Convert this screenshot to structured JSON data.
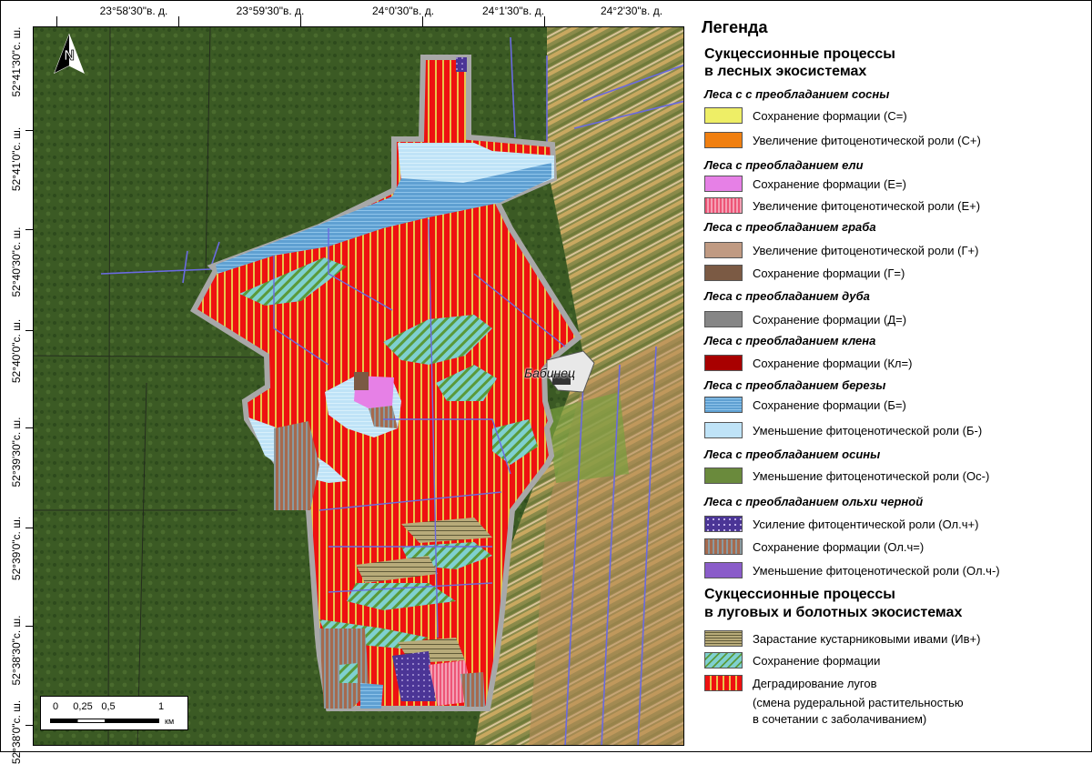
{
  "map": {
    "coord_top": [
      "23°58'30\"в. д.",
      "23°59'30\"в. д.",
      "24°0'30\"в. д.",
      "24°1'30\"в. д.",
      "24°2'30\"в. д."
    ],
    "coord_left": [
      "52°41'30\"с. ш.",
      "52°41'0\"с. ш.",
      "52°40'30\"с. ш.",
      "52°40'0\"с. ш.",
      "52°39'30\"с. ш.",
      "52°39'0\"с. ш.",
      "52°38'30\"с. ш.",
      "52°38'0\"с. ш."
    ],
    "place_name": "Бабинец",
    "north_label": "N",
    "scale": {
      "labels": [
        "0",
        "0,25",
        "0,5",
        "1"
      ],
      "unit": "км"
    }
  },
  "legend": {
    "title": "Легенда",
    "forest_title_1": "Сукцессионные процессы",
    "forest_title_2": "в лесных экосистемах",
    "meadow_title_1": "Сукцессионные процессы",
    "meadow_title_2": "в луговых и болотных экосистемах",
    "groups": [
      {
        "title": "Леса с с преобладанием сосны",
        "items": [
          {
            "label": "Сохранение формации (С=)",
            "color": "#eeee66"
          },
          {
            "label": "Увеличение фитоценотической роли (С+)",
            "color": "#f07f10"
          }
        ]
      },
      {
        "title": "Леса с преобладанием ели",
        "items": [
          {
            "label": "Сохранение формации (Е=)",
            "color": "#e680e6"
          },
          {
            "label": "Увеличение фитоценотической роли (Е+)",
            "color": "#ee5577"
          }
        ]
      },
      {
        "title": "Леса с преобладанием граба",
        "items": [
          {
            "label": "Увеличение фитоценотической роли (Г+)",
            "color": "#c09a82"
          },
          {
            "label": "Сохранение формации (Г=)",
            "color": "#7b5a44"
          }
        ]
      },
      {
        "title": "Леса с преобладанием дуба",
        "items": [
          {
            "label": "Сохранение формации (Д=)",
            "color": "#868686"
          }
        ]
      },
      {
        "title": "Леса с преобладанием клена",
        "items": [
          {
            "label": "Сохранение формации (Кл=)",
            "color": "#a80000"
          }
        ]
      },
      {
        "title": "Леса с преобладанием березы",
        "items": [
          {
            "label": "Сохранение формации (Б=)",
            "color": "#5fa0d2"
          },
          {
            "label": "Уменьшение фитоценотической роли (Б-)",
            "color": "#bfe3f7"
          }
        ]
      },
      {
        "title": "Леса с преобладанием осины",
        "items": [
          {
            "label": "Уменьшение фитоценотической роли (Ос-)",
            "color": "#6a8a3c"
          }
        ]
      },
      {
        "title": "Леса с преобладанием ольхи черной",
        "items": [
          {
            "label": "Усиление фитоцентической роли (Ол.ч+)",
            "color": "#4b3596"
          },
          {
            "label": "Сохранение формации (Ол.ч=)",
            "color": "#a66a4e"
          },
          {
            "label": "Уменьшение фитоценотической роли (Ол.ч-)",
            "color": "#8a5cc9"
          }
        ]
      }
    ],
    "meadow_items": [
      {
        "label": "Зарастание кустарниковыми ивами (Ив+)",
        "color": "#b8ab7a"
      },
      {
        "label": "Сохранение формации",
        "color": "#7fd0d0"
      },
      {
        "label": "Деградирование лугов",
        "color": "#ee1111"
      }
    ],
    "meadow_note_1": "(смена рудеральной растительностью",
    "meadow_note_2": "в сочетании с заболачиванием)"
  }
}
